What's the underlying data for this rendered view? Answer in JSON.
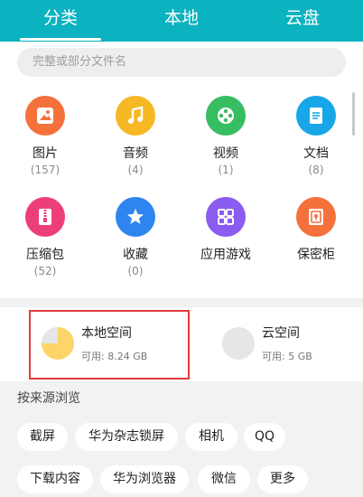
{
  "tabs": [
    {
      "label": "分类",
      "active": true
    },
    {
      "label": "本地",
      "active": false
    },
    {
      "label": "云盘",
      "active": false
    }
  ],
  "search": {
    "placeholder": "完整或部分文件名"
  },
  "categories": [
    {
      "name": "图片",
      "count": "(157)",
      "icon": "image-icon",
      "color": "#f5713c"
    },
    {
      "name": "音频",
      "count": "(4)",
      "icon": "music-note-icon",
      "color": "#f7b825"
    },
    {
      "name": "视频",
      "count": "(1)",
      "icon": "film-reel-icon",
      "color": "#37bd62"
    },
    {
      "name": "文档",
      "count": "(8)",
      "icon": "document-icon",
      "color": "#17a7e8"
    },
    {
      "name": "压缩包",
      "count": "(52)",
      "icon": "zip-archive-icon",
      "color": "#ec3f78"
    },
    {
      "name": "收藏",
      "count": "(0)",
      "icon": "star-icon",
      "color": "#2f85ef"
    },
    {
      "name": "应用游戏",
      "count": "",
      "icon": "apps-grid-icon",
      "color": "#8a5cf0"
    },
    {
      "name": "保密柜",
      "count": "",
      "icon": "safe-lock-icon",
      "color": "#f5713c"
    }
  ],
  "storage": {
    "local": {
      "title": "本地空间",
      "available": "可用: 8.24 GB",
      "used_fraction": 0.25
    },
    "cloud": {
      "title": "云空间",
      "available": "可用: 5 GB",
      "used_fraction": 0
    }
  },
  "source_section": {
    "title": "按来源浏览",
    "chips": [
      "截屏",
      "华为杂志锁屏",
      "相机",
      "QQ",
      "下载内容",
      "华为浏览器",
      "微信",
      "更多"
    ]
  },
  "colors": {
    "accent": "#0bb2bf",
    "highlight": "#e23a3a",
    "pie_used": "#fcd469",
    "pie_free": "#e6e6e6"
  }
}
